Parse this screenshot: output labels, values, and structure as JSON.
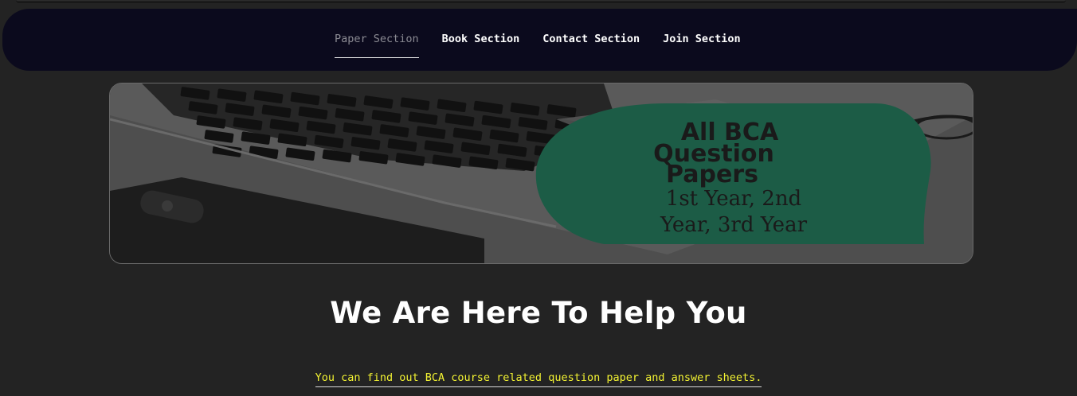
{
  "nav": {
    "items": [
      {
        "label": "Paper Section",
        "active": true
      },
      {
        "label": "Book Section",
        "active": false
      },
      {
        "label": "Contact Section",
        "active": false
      },
      {
        "label": "Join Section",
        "active": false
      }
    ]
  },
  "banner": {
    "title_lines": [
      "All BCA",
      "Question",
      "Papers"
    ],
    "subtitle_lines": [
      "1st Year, 2nd",
      "Year, 3rd Year"
    ]
  },
  "main": {
    "headline": "We Are Here To Help You",
    "subtext": "You can find out BCA course related question paper and answer sheets."
  },
  "colors": {
    "navbar_bg": "#0b0a1d",
    "page_bg": "#232323",
    "bubble_green": "#1c5c46",
    "subtext_yellow": "#f2f232"
  }
}
